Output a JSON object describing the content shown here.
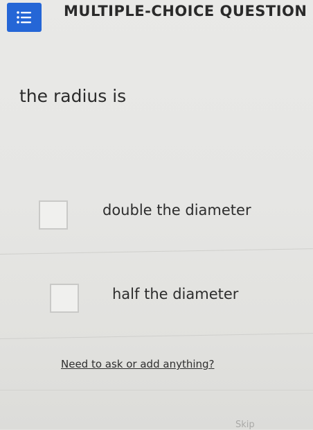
{
  "header": {
    "icon": "list-icon",
    "title": "MULTIPLE-CHOICE QUESTION",
    "accent_color": "#2566d6"
  },
  "question": {
    "text": "the radius is"
  },
  "choices": [
    {
      "label": "double the diameter",
      "checked": false
    },
    {
      "label": "half the diameter",
      "checked": false
    }
  ],
  "footer": {
    "help_link": "Need to ask or add anything?",
    "skip_label": "Skip"
  }
}
